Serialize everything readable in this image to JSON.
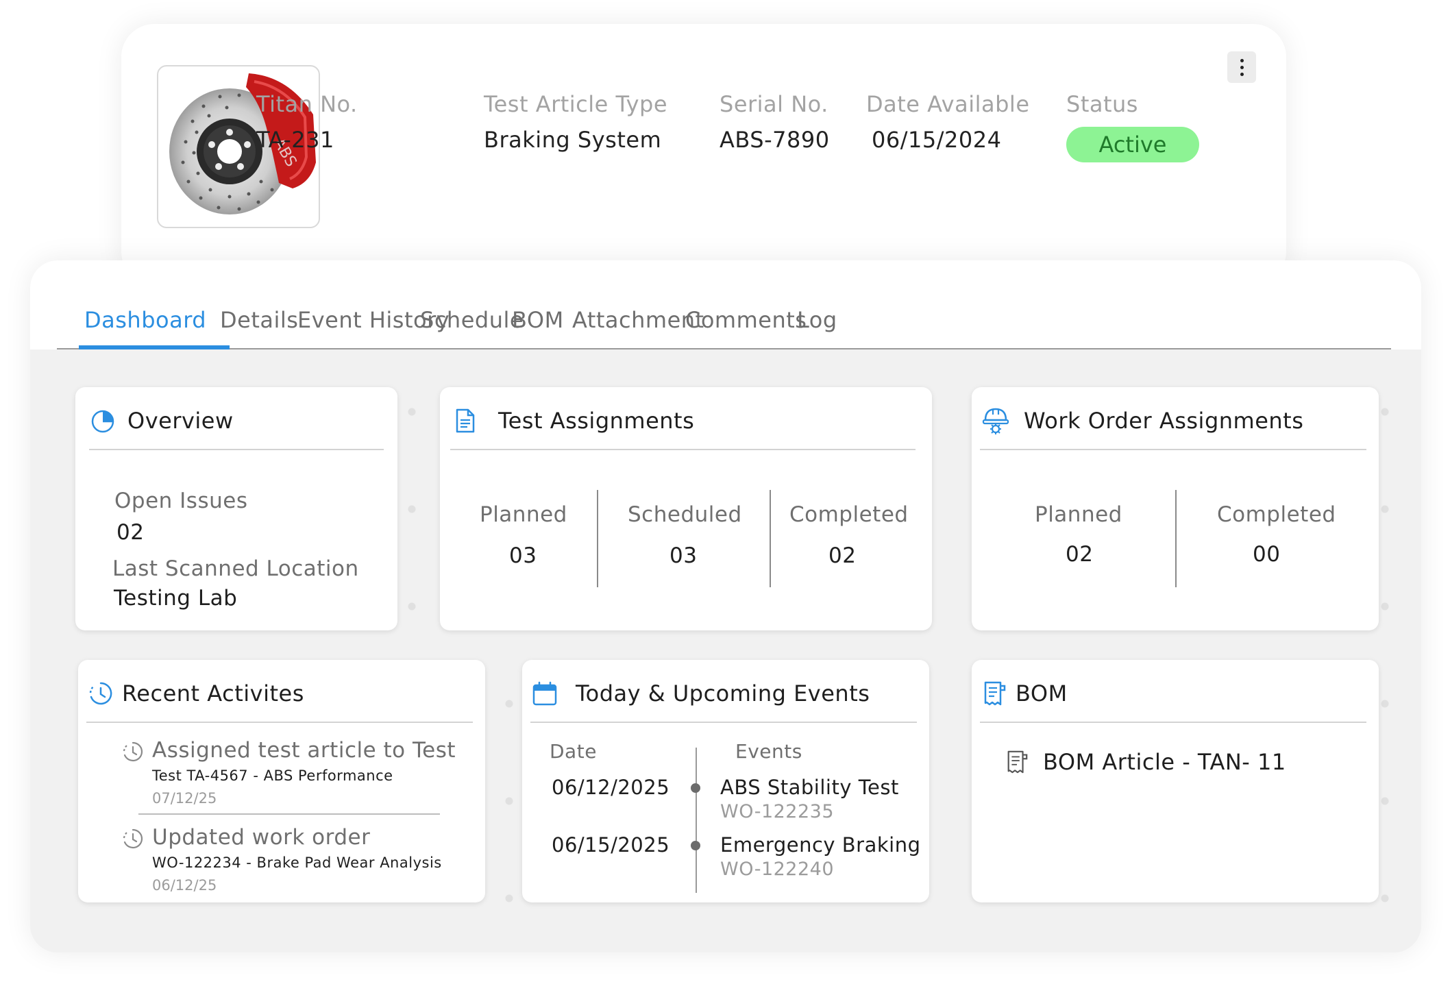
{
  "article": {
    "fields": [
      {
        "label": "Titan No.",
        "value": "TA-231"
      },
      {
        "label": "Test Article Type",
        "value": "Braking System"
      },
      {
        "label": "Serial No.",
        "value": "ABS-7890"
      },
      {
        "label": "Date Available",
        "value": "06/15/2024"
      },
      {
        "label": "Status",
        "value": "Active"
      }
    ],
    "image_icon": "brake-disc-with-caliper",
    "caliper_text": "ABS",
    "status_color": "#8df394",
    "more_icon": "kebab-menu-icon"
  },
  "tabs": [
    {
      "label": "Dashboard",
      "active": true
    },
    {
      "label": "Details"
    },
    {
      "label": "Event History"
    },
    {
      "label": "Schedule"
    },
    {
      "label": "BOM"
    },
    {
      "label": "Attachment"
    },
    {
      "label": "Comments"
    },
    {
      "label": "Log"
    }
  ],
  "accent_color": "#2b8ee0",
  "overview": {
    "title": "Overview",
    "icon": "pie-chart-icon",
    "open_issues_label": "Open Issues",
    "open_issues_value": "02",
    "last_location_label": "Last Scanned Location",
    "last_location_value": "Testing Lab"
  },
  "test_assignments": {
    "title": "Test Assignments",
    "icon": "document-icon",
    "stats": [
      {
        "label": "Planned",
        "value": "03"
      },
      {
        "label": "Scheduled",
        "value": "03"
      },
      {
        "label": "Completed",
        "value": "02"
      }
    ]
  },
  "work_orders": {
    "title": "Work Order Assignments",
    "icon": "hard-hat-gear-icon",
    "stats": [
      {
        "label": "Planned",
        "value": "02"
      },
      {
        "label": "Completed",
        "value": "00"
      }
    ]
  },
  "recent": {
    "title": "Recent Activites",
    "icon": "clock-history-icon",
    "items": [
      {
        "title": "Assigned test article to Test",
        "sub": "Test TA-4567 - ABS Performance",
        "date": "07/12/25"
      },
      {
        "title": "Updated work order",
        "sub": "WO-122234 - Brake Pad Wear Analysis",
        "date": "06/12/25"
      }
    ]
  },
  "events": {
    "title": "Today & Upcoming Events",
    "icon": "calendar-icon",
    "col_date": "Date",
    "col_events": "Events",
    "items": [
      {
        "date": "06/12/2025",
        "name": "ABS Stability Test",
        "wo": "WO-122235"
      },
      {
        "date": "06/15/2025",
        "name": "Emergency Braking",
        "wo": "WO-122240"
      }
    ]
  },
  "bom": {
    "title": "BOM",
    "icon": "receipt-icon",
    "item": "BOM Article - TAN- 11",
    "item_icon": "receipt-icon"
  }
}
